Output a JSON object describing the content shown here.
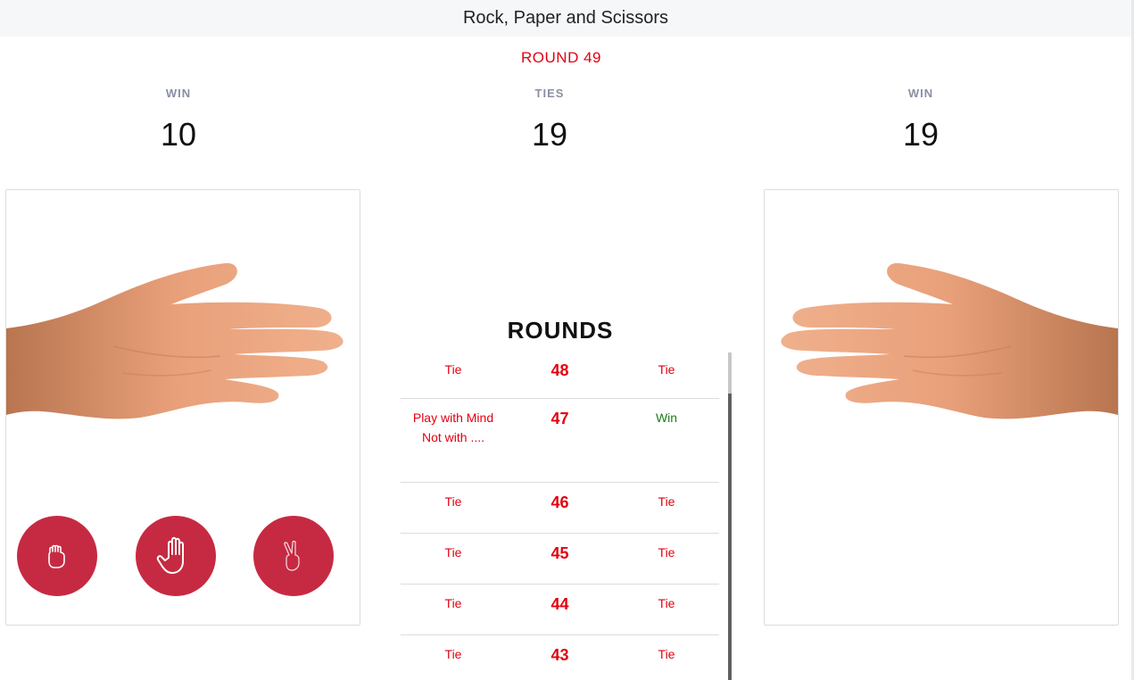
{
  "header": {
    "title": "Rock, Paper and Scissors"
  },
  "round": {
    "label": "ROUND 49"
  },
  "scores": {
    "left": {
      "label": "WIN",
      "value": "10"
    },
    "ties": {
      "label": "TIES",
      "value": "19"
    },
    "right": {
      "label": "WIN",
      "value": "19"
    }
  },
  "player_card": {
    "hand": "paper-hand-right-pointing"
  },
  "computer_card": {
    "hand": "paper-hand-left-pointing"
  },
  "choices": [
    {
      "name": "rock",
      "icon": "fist-icon"
    },
    {
      "name": "paper",
      "icon": "open-hand-icon"
    },
    {
      "name": "scissors",
      "icon": "peace-sign-icon"
    }
  ],
  "rounds": {
    "title": "ROUNDS",
    "rows": [
      {
        "left": "Tie",
        "round": "48",
        "right": "Tie",
        "right_status": "tie"
      },
      {
        "left": "Play with Mind Not with ....",
        "round": "47",
        "right": "Win",
        "right_status": "win"
      },
      {
        "left": "Tie",
        "round": "46",
        "right": "Tie",
        "right_status": "tie"
      },
      {
        "left": "Tie",
        "round": "45",
        "right": "Tie",
        "right_status": "tie"
      },
      {
        "left": "Tie",
        "round": "44",
        "right": "Tie",
        "right_status": "tie"
      },
      {
        "left": "Tie",
        "round": "43",
        "right": "Tie",
        "right_status": "tie"
      }
    ]
  },
  "colors": {
    "accent_red": "#e3000f",
    "button_red": "#c62a42",
    "win_green": "#1a7d1a",
    "label_gray": "#8a8fa3"
  }
}
